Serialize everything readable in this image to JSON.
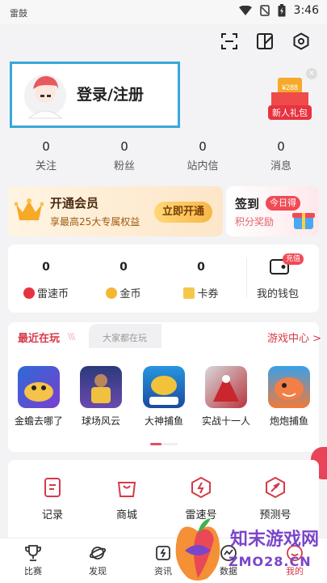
{
  "status_bar": {
    "carrier": "雷鼓",
    "time": "3:46"
  },
  "profile": {
    "login_label": "登录/注册"
  },
  "gift": {
    "amount": "¥288",
    "label": "新人礼包",
    "close": "×"
  },
  "stats": [
    {
      "value": "0",
      "label": "关注"
    },
    {
      "value": "0",
      "label": "粉丝"
    },
    {
      "value": "0",
      "label": "站内信"
    },
    {
      "value": "0",
      "label": "消息"
    }
  ],
  "vip": {
    "title": "开通会员",
    "subtitle": "享最高25大专属权益",
    "button": "立即开通"
  },
  "signin": {
    "title": "签到",
    "badge": "今日得",
    "subtitle": "积分奖励"
  },
  "wallet": {
    "items": [
      {
        "value": "0",
        "label": "雷速币"
      },
      {
        "value": "0",
        "label": "金币"
      },
      {
        "value": "0",
        "label": "卡券"
      }
    ],
    "recharge_badge": "充值",
    "label": "我的钱包"
  },
  "games": {
    "tab_recent": "最近在玩",
    "tab_recent_deco": "\\\\\\",
    "tab_others": "大家都在玩",
    "center_link": "游戏中心 >",
    "items": [
      {
        "name": "金蟾去哪了"
      },
      {
        "name": "球场风云"
      },
      {
        "name": "大神捕鱼"
      },
      {
        "name": "实战十一人"
      },
      {
        "name": "炮炮捕鱼"
      }
    ]
  },
  "tools": [
    {
      "label": "记录"
    },
    {
      "label": "商城"
    },
    {
      "label": "雷速号"
    },
    {
      "label": "预测号"
    }
  ],
  "nav": [
    {
      "label": "比赛"
    },
    {
      "label": "发现"
    },
    {
      "label": "资讯"
    },
    {
      "label": "数据"
    },
    {
      "label": "我的"
    }
  ],
  "watermark": {
    "title": "知末游戏网",
    "url": "ZMO28.CN"
  },
  "colors": {
    "accent": "#d63a48",
    "highlight_border": "#36a9d8",
    "vip_gold": "#f5b748"
  }
}
